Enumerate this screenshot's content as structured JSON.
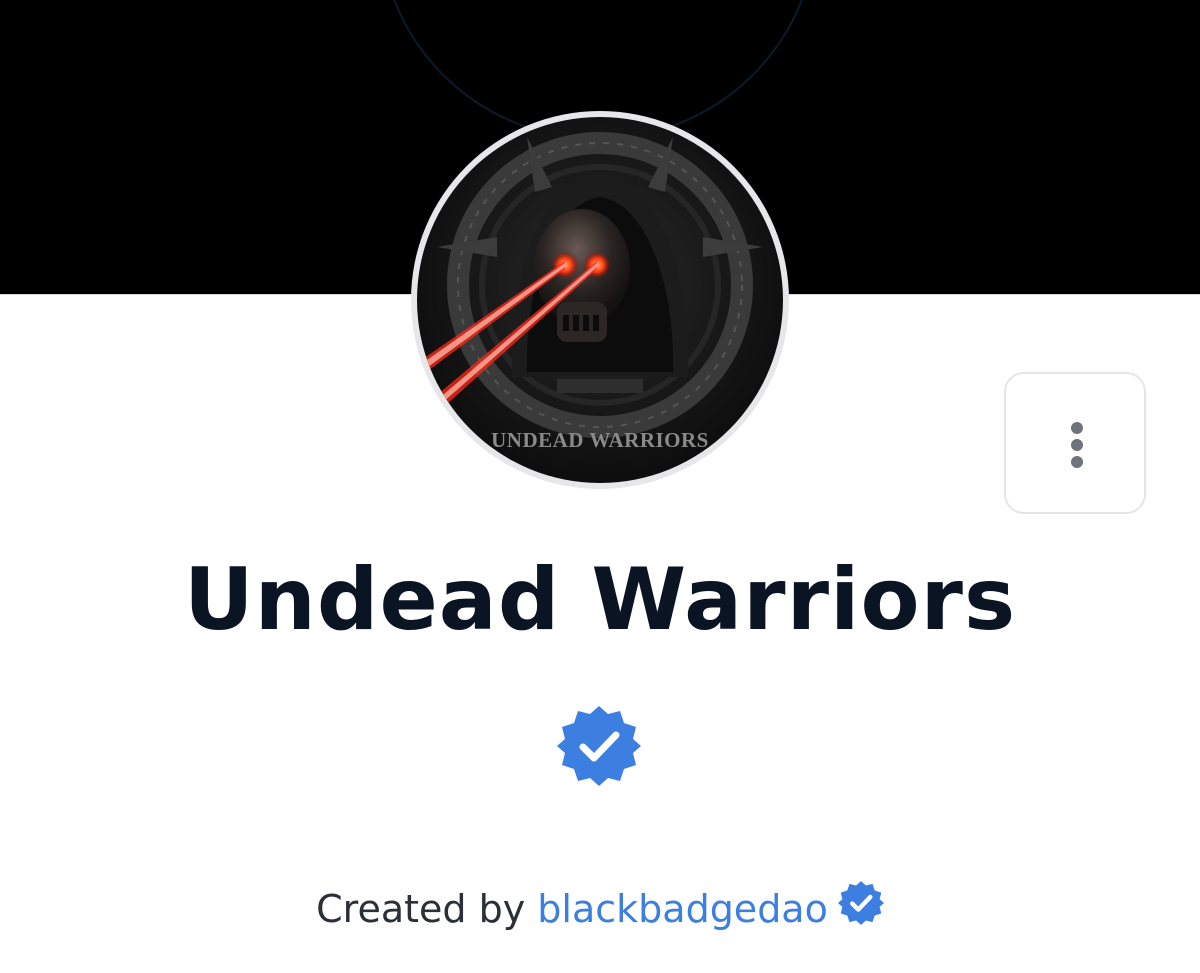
{
  "collection": {
    "name": "Undead Warriors",
    "verified": true,
    "avatar_caption": "UNDEAD WARRIORS"
  },
  "creator": {
    "prefix": "Created by",
    "name": "blackbadgedao",
    "verified": true
  },
  "icons": {
    "more": "more-vertical-icon",
    "verified": "verified-badge-icon"
  },
  "colors": {
    "banner": "#000000",
    "title": "#0b1423",
    "accent": "#3d7fe0",
    "border": "#e3e5e8"
  }
}
